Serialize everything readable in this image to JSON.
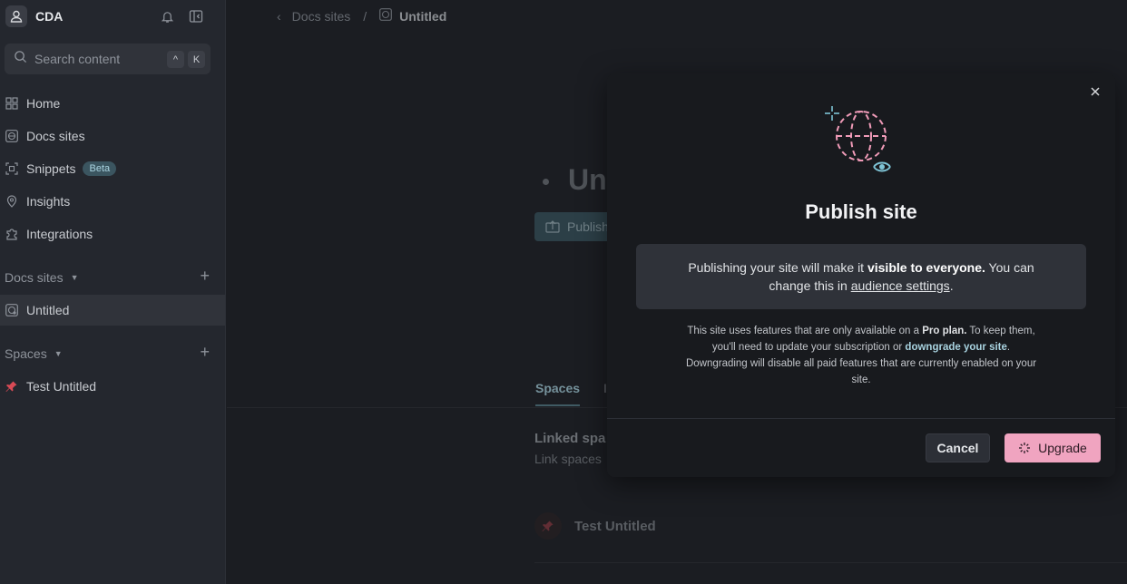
{
  "sidebar": {
    "org_name": "CDA",
    "search": {
      "placeholder": "Search content",
      "key1": "^",
      "key2": "K"
    },
    "nav": [
      {
        "label": "Home",
        "icon": "home-icon"
      },
      {
        "label": "Docs sites",
        "icon": "globe-icon"
      },
      {
        "label": "Snippets",
        "icon": "snippets-icon",
        "badge": "Beta"
      },
      {
        "label": "Insights",
        "icon": "insights-icon"
      },
      {
        "label": "Integrations",
        "icon": "puzzle-icon"
      }
    ],
    "docs_sites_header": "Docs sites",
    "docs_sites": [
      {
        "label": "Untitled",
        "icon": "site-icon"
      }
    ],
    "spaces_header": "Spaces",
    "spaces": [
      {
        "label": "Test Untitled",
        "icon": "pin-icon"
      }
    ]
  },
  "main": {
    "breadcrumb": {
      "parent": "Docs sites",
      "current": "Untitled"
    },
    "title_fragment": "Unt",
    "publish_fragment": "Publish",
    "tabs": [
      {
        "label": "Spaces"
      },
      {
        "label": "I"
      }
    ],
    "linked_title": "Linked spa",
    "linked_sub": "Link spaces",
    "space_row": "Test Untitled"
  },
  "modal": {
    "title": "Publish site",
    "notice": {
      "pre": "Publishing your site will make it ",
      "bold": "visible to everyone.",
      "post": " You can change this in ",
      "link": "audience settings",
      "end": "."
    },
    "info": {
      "pre": "This site uses features that are only available on a ",
      "bold": "Pro plan.",
      "mid": " To keep them, you'll need to update your subscription or ",
      "link": "downgrade your site",
      "post": ". Downgrading will disable all paid features that are currently enabled on your site."
    },
    "cancel_label": "Cancel",
    "upgrade_label": "Upgrade"
  },
  "colors": {
    "accent": "#a9d3e0",
    "upgrade": "#f0a4c0",
    "modal_bg": "#181a1e"
  }
}
